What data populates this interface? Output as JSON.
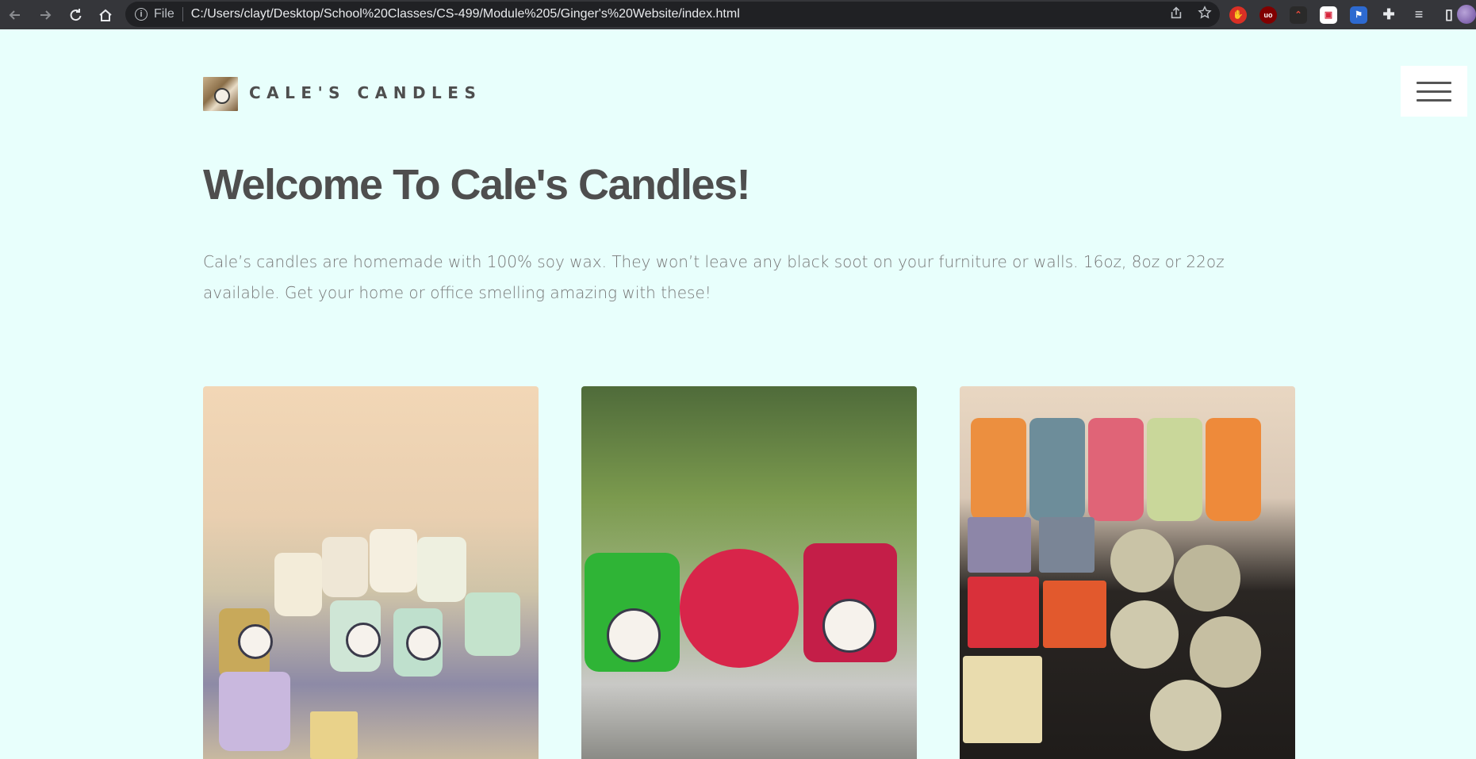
{
  "browser": {
    "file_label": "File",
    "url": "C:/Users/clayt/Desktop/School%20Classes/CS-499/Module%205/Ginger's%20Website/index.html",
    "icons": [
      "back-icon",
      "forward-icon",
      "reload-icon",
      "home-icon",
      "info-icon",
      "share-icon",
      "star-icon",
      "extensions-icon",
      "reading-list-icon",
      "sidebar-icon"
    ],
    "ext_ub": "uo"
  },
  "site": {
    "brand": "CALE'S CANDLES",
    "heading": "Welcome To Cale's Candles!",
    "intro": "Cale’s candles are homemade with 100% soy wax. They won’t leave any black soot on your furniture or walls. 16oz, 8oz or 22oz available. Get your home or office smelling amazing with these!"
  },
  "colors": {
    "page_background": "#e8fffc",
    "text_dark": "#4e4e4e",
    "text_muted": "#777777"
  }
}
